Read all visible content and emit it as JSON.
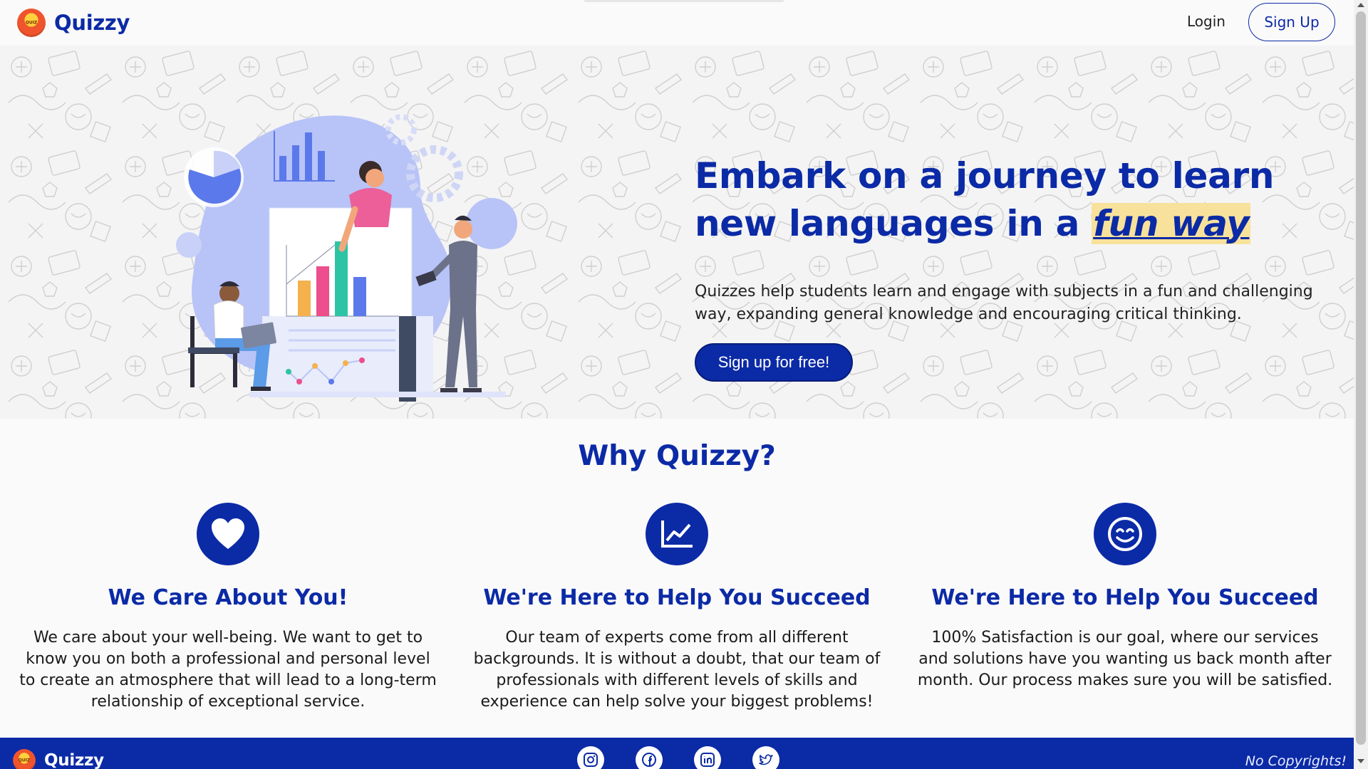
{
  "header": {
    "brand": "Quizzy",
    "login_label": "Login",
    "signup_label": "Sign Up"
  },
  "hero": {
    "title_part1": "Embark on a journey to learn new languages in a",
    "title_highlight": "fun way",
    "description": "Quizzes help students learn and engage with subjects in a fun and challenging way, expanding general knowledge and encouraging critical thinking.",
    "cta_label": "Sign up for free!"
  },
  "why": {
    "title": "Why Quizzy?",
    "features": [
      {
        "icon": "heart-icon",
        "title": "We Care About You!",
        "text": "We care about your well-being. We want to get to know you on both a professional and personal level to create an atmosphere that will lead to a long-term relationship of exceptional service."
      },
      {
        "icon": "chart-line-icon",
        "title": "We're Here to Help You Succeed",
        "text": "Our team of experts come from all different backgrounds. It is without a doubt, that our team of professionals with different levels of skills and experience can help solve your biggest problems!"
      },
      {
        "icon": "smile-icon",
        "title": "We're Here to Help You Succeed",
        "text": "100% Satisfaction is our goal, where our services and solutions have you wanting us back month after month. Our process makes sure you will be satisfied."
      }
    ]
  },
  "footer": {
    "brand": "Quizzy",
    "socials": [
      "instagram-icon",
      "facebook-icon",
      "linkedin-icon",
      "twitter-icon"
    ],
    "copyright": "No Copyrights!"
  },
  "colors": {
    "primary": "#0b2aa6",
    "highlight": "#f8e29b",
    "background": "#fbfafa"
  }
}
